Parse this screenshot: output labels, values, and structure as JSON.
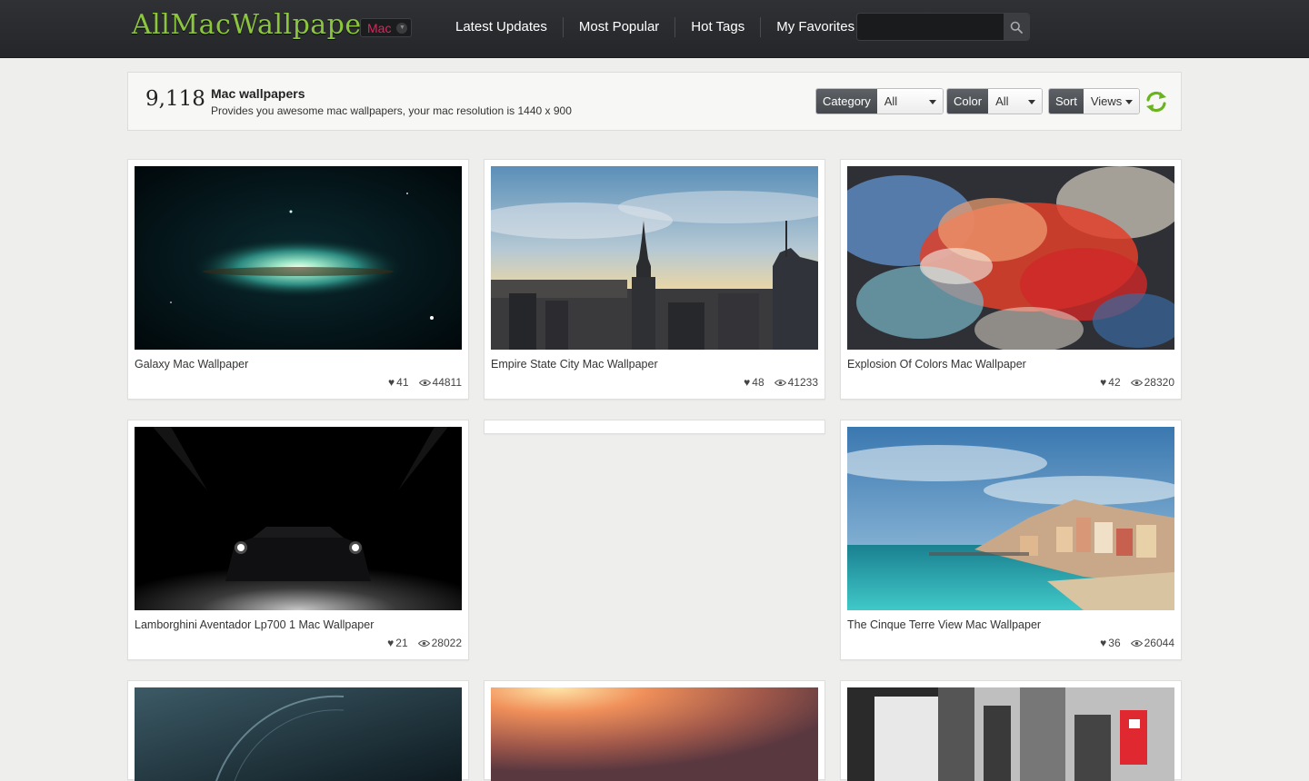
{
  "header": {
    "logo": "AllMacWallpaper",
    "platform": "Mac",
    "nav": [
      "Latest Updates",
      "Most Popular",
      "Hot Tags",
      "My Favorites"
    ],
    "search_placeholder": ""
  },
  "info": {
    "count": "9,118",
    "title": "Mac wallpapers",
    "description": "Provides you awesome mac wallpapers, your mac resolution is 1440 x 900"
  },
  "filters": {
    "category_label": "Category",
    "category_value": "All",
    "color_label": "Color",
    "color_value": "All",
    "sort_label": "Sort",
    "sort_value": "Views"
  },
  "colors": {
    "logo": "#8cc63f",
    "platform": "#e0245e",
    "refresh": "#6ab41e"
  },
  "wallpapers": [
    {
      "title": "Galaxy Mac Wallpaper",
      "likes": "41",
      "views": "44811"
    },
    {
      "title": "Empire State City Mac Wallpaper",
      "likes": "48",
      "views": "41233"
    },
    {
      "title": "Explosion Of Colors Mac Wallpaper",
      "likes": "42",
      "views": "28320"
    },
    {
      "title": "Lamborghini Aventador Lp700 1 Mac Wallpaper",
      "likes": "21",
      "views": "28022"
    },
    {
      "title": "The Cinque Terre View Mac Wallpaper",
      "likes": "36",
      "views": "26044"
    }
  ]
}
